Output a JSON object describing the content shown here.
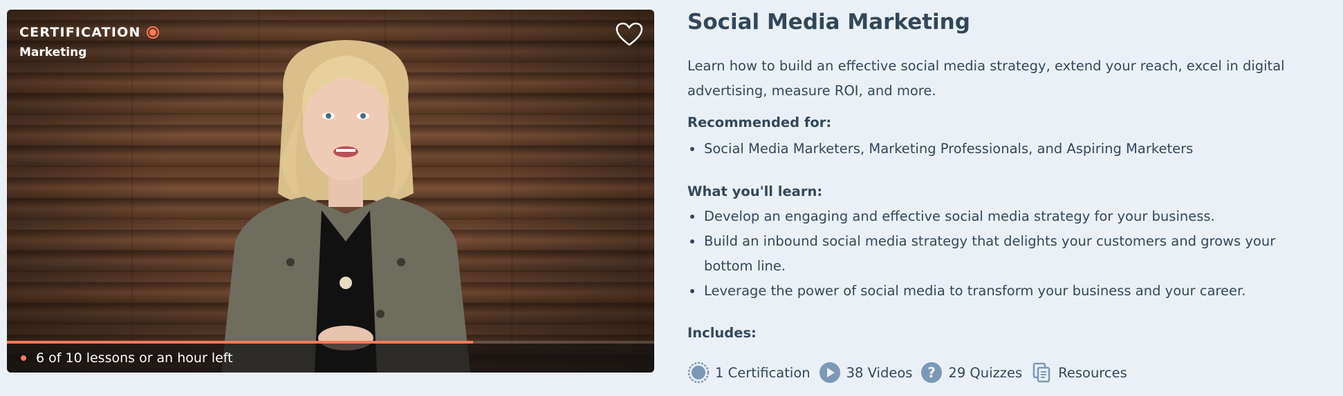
{
  "course": {
    "badge": "CERTIFICATION",
    "category": "Marketing",
    "title": "Social Media Marketing",
    "description": "Learn how to build an effective social media strategy, extend your reach, excel in digital advertising, measure ROI, and more.",
    "progress": {
      "text": "6 of 10 lessons or an hour left",
      "completed": 6,
      "total": 10
    },
    "recommended": {
      "heading": "Recommended for:",
      "items": [
        "Social Media Marketers, Marketing Professionals, and Aspiring Marketers"
      ]
    },
    "learn": {
      "heading": "What you'll learn:",
      "items": [
        "Develop an engaging and effective social media strategy for your business.",
        "Build an inbound social media strategy that delights your customers and grows your bottom line.",
        "Leverage the power of social media to transform your business and your career."
      ]
    },
    "includes": {
      "heading": "Includes:",
      "items": [
        {
          "icon": "certification-icon",
          "label": "1 Certification"
        },
        {
          "icon": "play-icon",
          "label": "38 Videos"
        },
        {
          "icon": "question-icon",
          "label": "29 Quizzes"
        },
        {
          "icon": "document-icon",
          "label": "Resources"
        }
      ]
    }
  },
  "colors": {
    "accent": "#ff7a59",
    "text": "#33475b",
    "icon": "#7c98b6",
    "background": "#eaf0f6"
  }
}
